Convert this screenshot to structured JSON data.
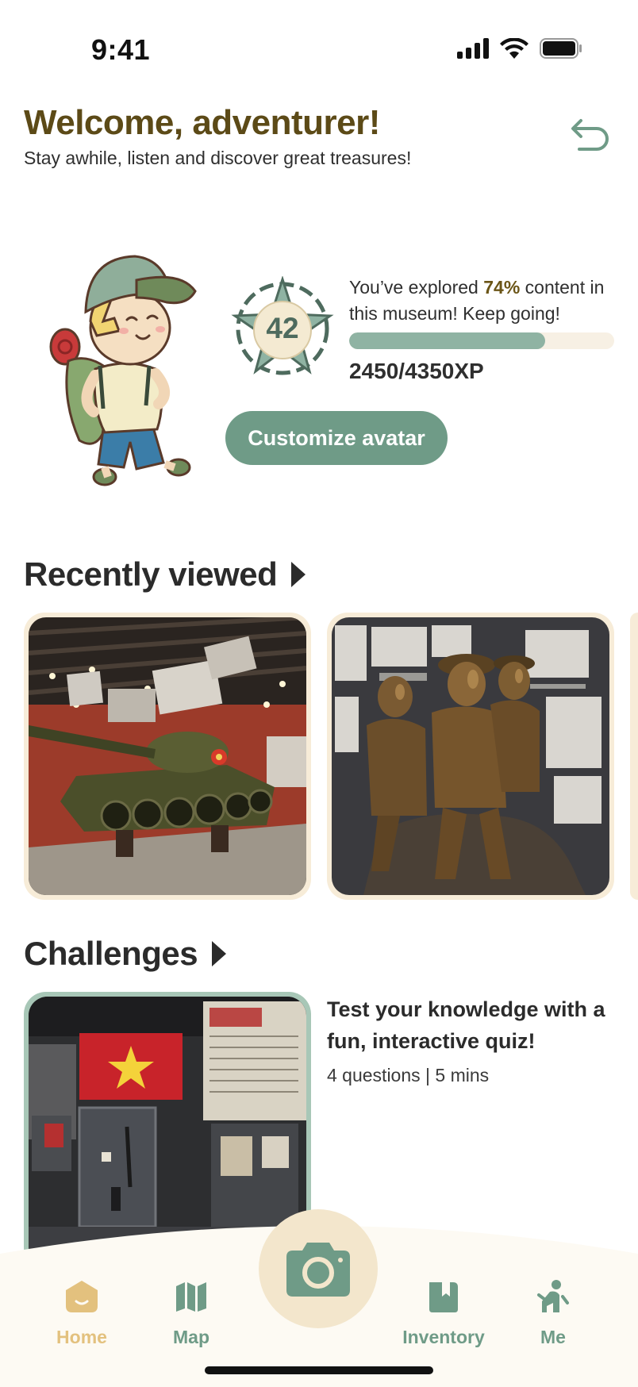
{
  "status": {
    "time": "9:41"
  },
  "header": {
    "title": "Welcome, adventurer!",
    "subtitle": "Stay awhile, listen and discover great treasures!"
  },
  "profile": {
    "level": "42",
    "progress_prefix": "You’ve explored ",
    "progress_percent_text": "74%",
    "progress_suffix": " content in this museum! Keep going!",
    "progress_fraction": 0.74,
    "xp_text": "2450/4350XP",
    "customize_label": "Customize avatar"
  },
  "recently_viewed": {
    "title": "Recently viewed",
    "items": [
      {
        "name": "tank-exhibit"
      },
      {
        "name": "bronze-statue-exhibit"
      }
    ]
  },
  "challenges": {
    "title": "Challenges",
    "quiz_title": "Test your knowledge with a fun, interactive quiz!",
    "quiz_meta": "4 questions | 5 mins"
  },
  "tabs": [
    {
      "label": "Home",
      "icon": "home-icon",
      "active": true
    },
    {
      "label": "Map",
      "icon": "map-icon",
      "active": false
    },
    {
      "label": "Inventory",
      "icon": "inventory-icon",
      "active": false
    },
    {
      "label": "Me",
      "icon": "person-icon",
      "active": false
    }
  ],
  "colors": {
    "accent": "#6f9b87",
    "brand_brown": "#5c4a17",
    "active_tab": "#e3c17e",
    "cream": "#f3e6cc"
  }
}
